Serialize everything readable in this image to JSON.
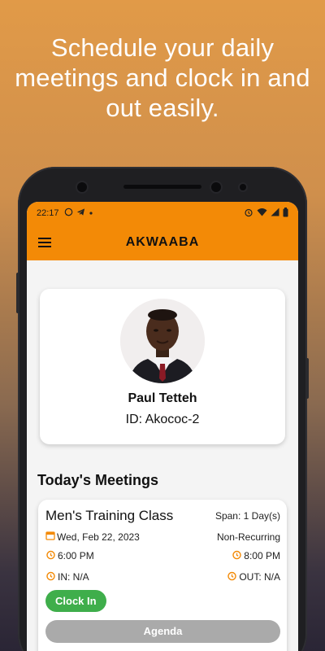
{
  "headline": "Schedule your daily meetings and clock in and out easily.",
  "status_bar": {
    "time": "22:17"
  },
  "app_bar": {
    "title": "AKWAABA"
  },
  "profile": {
    "name": "Paul Tetteh",
    "id_text": "ID: Akococ-2"
  },
  "meetings_section": {
    "title": "Today's Meetings"
  },
  "meeting": {
    "title": "Men's Training Class",
    "span": "Span: 1 Day(s)",
    "date": "Wed, Feb 22, 2023",
    "recurrence": "Non-Recurring",
    "start_time": "6:00 PM",
    "end_time": "8:00 PM",
    "clock_in": "IN: N/A",
    "clock_out": "OUT: N/A",
    "clock_in_button": "Clock In",
    "agenda_button": "Agenda"
  },
  "colors": {
    "accent": "#f38a06",
    "clock_in_green": "#3fae4b",
    "agenda_gray": "#aaaaaa"
  }
}
